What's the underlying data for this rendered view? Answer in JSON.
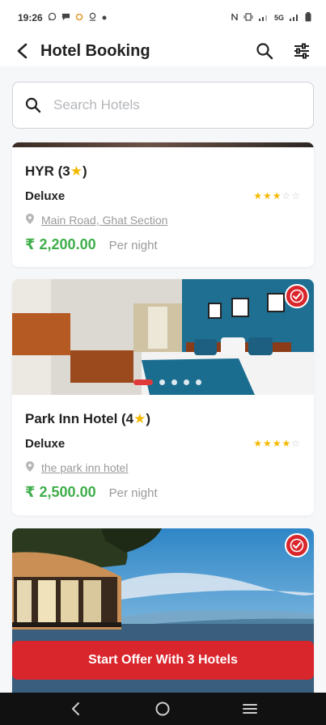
{
  "status_bar": {
    "time": "19:26",
    "right_text": "5G"
  },
  "app_bar": {
    "title": "Hotel Booking"
  },
  "search": {
    "placeholder": "Search Hotels"
  },
  "hotels": [
    {
      "name": "HYR (3",
      "stars": 3,
      "room_type": "Deluxe",
      "location": "Main Road, Ghat Section",
      "price": "₹ 2,200.00",
      "per_night": "Per night",
      "selected": false
    },
    {
      "name": "Park Inn Hotel (4",
      "stars": 4,
      "room_type": "Deluxe",
      "location": "the park inn hotel",
      "price": "₹ 2,500.00",
      "per_night": "Per night",
      "selected": true
    },
    {
      "selected": true
    }
  ],
  "cta": {
    "label": "Start Offer With 3 Hotels"
  },
  "colors": {
    "accent": "#d9262c",
    "price": "#3fae4a",
    "star": "#f5b800"
  }
}
